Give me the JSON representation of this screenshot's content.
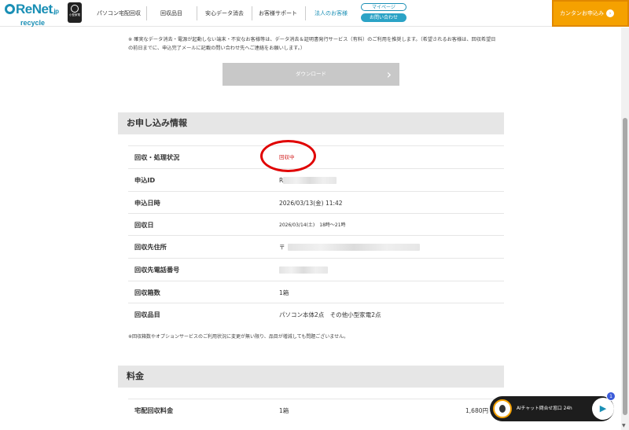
{
  "header": {
    "logo_main": "ReNet",
    "logo_suffix": ".jp",
    "logo_sub": "recycle",
    "badge_text": "小型家電",
    "nav": [
      "パソコン宅配回収",
      "回収品目",
      "安心データ消去",
      "お客様サポート"
    ],
    "nav_corporate": "法人のお客様",
    "mypage": "マイページ",
    "contact": "お問い合わせ",
    "apply": "カンタンお申込み",
    "apply_icon": "arrow-right-icon"
  },
  "notes": {
    "top": "※ 確実なデータ消去・電源が起動しない端末・不安なお客様等は、データ消去＆証明書発行サービス（有料）のご利用を推奨します。（希望されるお客様は、回収希望日の前日までに、申込完了メールに記載の問い合わせ先へご連絡をお願いします。）",
    "bottom": "※回収箱数やオプションサービスのご利用状況に変更が無い限り、品目が増減しても問題ございません。"
  },
  "download": {
    "label": "ダウンロード"
  },
  "application": {
    "title": "お申し込み情報",
    "rows": [
      {
        "label": "回収・処理状況",
        "value": "回収中"
      },
      {
        "label": "申込ID",
        "value": "R"
      },
      {
        "label": "申込日時",
        "value": "2026/03/13(金) 11:42"
      },
      {
        "label": "回収日",
        "value": "2026/03/14(土)　18時〜21時"
      },
      {
        "label": "回収先住所",
        "value": "〒"
      },
      {
        "label": "回収先電話番号",
        "value": ""
      },
      {
        "label": "回収箱数",
        "value": "1箱"
      },
      {
        "label": "回収品目",
        "value": "パソコン本体2点　その他小型家電2点"
      }
    ]
  },
  "fee": {
    "title": "料金",
    "rows": [
      {
        "label": "宅配回収料金",
        "value": "1箱",
        "price": "1,680円"
      }
    ]
  },
  "chat": {
    "label": "AIチャット問合せ窓口 24h",
    "count": "1"
  },
  "colors": {
    "brand": "#1a8fb5",
    "accent": "#f5a100",
    "status_red": "#d21e1e"
  }
}
